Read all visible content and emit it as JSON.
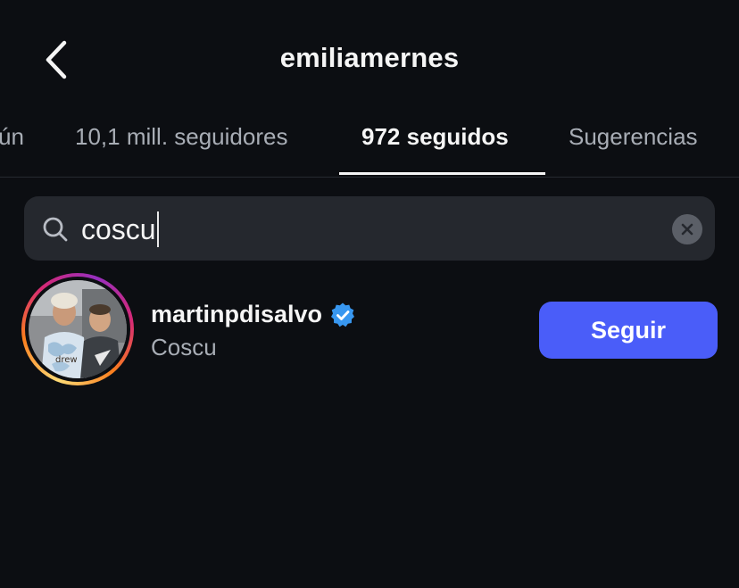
{
  "header": {
    "title": "emiliamernes",
    "back_icon": "chevron-left-icon"
  },
  "tabs": [
    {
      "label": "ún",
      "active": false
    },
    {
      "label": "10,1 mill. seguidores",
      "active": false
    },
    {
      "label": "972 seguidos",
      "active": true
    },
    {
      "label": "Sugerencias",
      "active": false
    }
  ],
  "search": {
    "value": "coscu",
    "icon": "search-icon",
    "clear_icon": "clear-icon"
  },
  "results": [
    {
      "username": "martinpdisalvo",
      "verified": true,
      "full_name": "Coscu",
      "action_label": "Seguir",
      "avatar_shirt_text": "drew"
    }
  ],
  "colors": {
    "background": "#0c0e12",
    "accent_button": "#4a5df9",
    "verified_badge": "#3897f0",
    "search_field": "#25282e",
    "secondary_text": "#a8adb5"
  }
}
